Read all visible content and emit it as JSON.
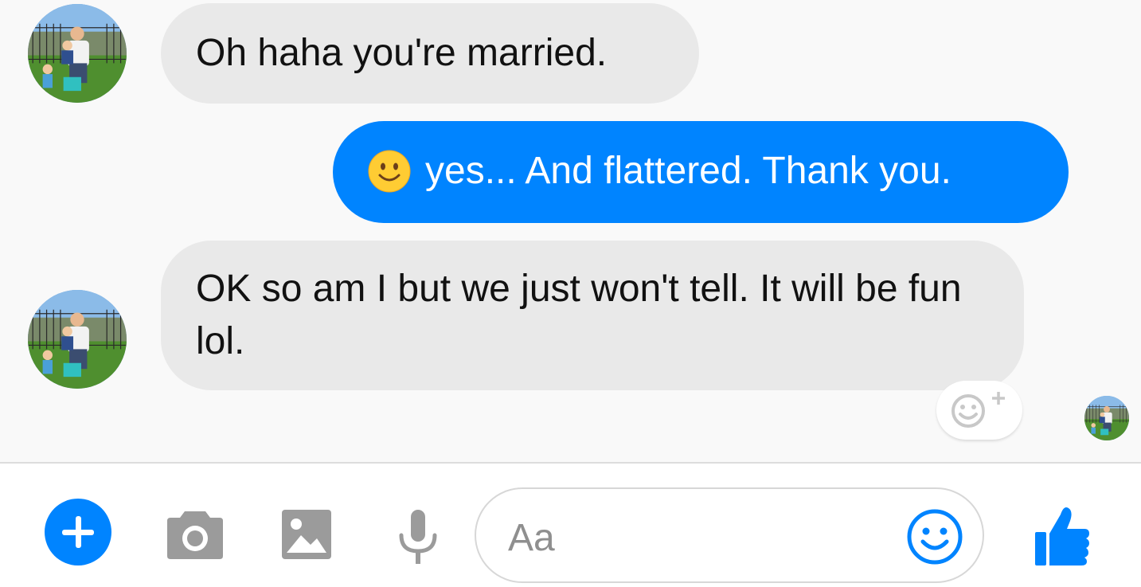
{
  "messages": [
    {
      "from": "contact",
      "text": "Oh haha you're married."
    },
    {
      "from": "me",
      "emoji": "slightly-smiling-face",
      "text": "yes... And flattered. Thank you."
    },
    {
      "from": "contact",
      "text": "OK so am I but we just won't tell. It will be fun lol."
    }
  ],
  "composer": {
    "placeholder": "Aa",
    "icons": [
      "plus-icon",
      "camera-icon",
      "image-icon",
      "microphone-icon",
      "emoji-icon",
      "thumbs-up-icon"
    ]
  },
  "colors": {
    "accent": "#0084ff",
    "incoming_bubble": "#e9e9e9",
    "background": "#f9f9f9",
    "tool_gray": "#9b9b9b"
  }
}
